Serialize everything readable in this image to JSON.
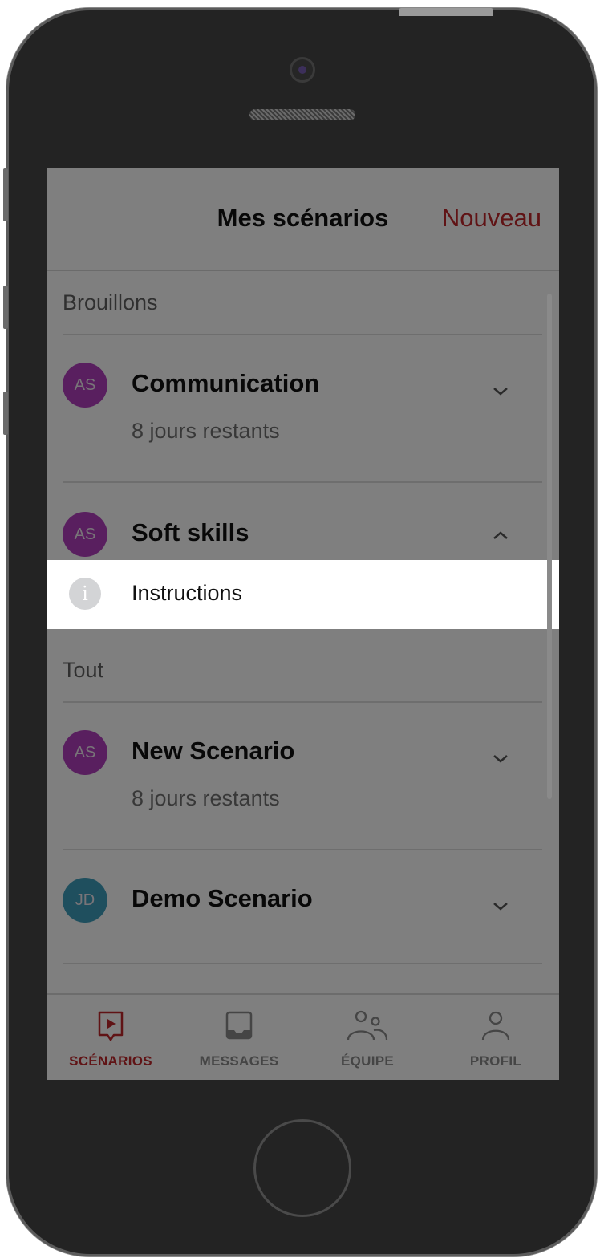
{
  "header": {
    "title": "Mes scénarios",
    "new_label": "Nouveau"
  },
  "sections": {
    "drafts_label": "Brouillons",
    "all_label": "Tout"
  },
  "drafts": [
    {
      "initials": "AS",
      "title": "Communication",
      "subtitle": "8 jours restants",
      "avatar_color": "#b23fbf"
    },
    {
      "initials": "AS",
      "title": "Soft skills",
      "avatar_color": "#b23fbf"
    }
  ],
  "instructions": {
    "label": "Instructions",
    "icon": "info-icon",
    "icon_glyph": "i"
  },
  "all": [
    {
      "initials": "AS",
      "title": "New Scenario",
      "subtitle": "8 jours restants",
      "avatar_color": "#b23fbf"
    },
    {
      "initials": "JD",
      "title": "Demo Scenario",
      "avatar_color": "#3e9fbd"
    }
  ],
  "tabs": [
    {
      "label": "SCÉNARIOS",
      "icon": "play-icon",
      "active": true
    },
    {
      "label": "MESSAGES",
      "icon": "inbox-icon",
      "active": false
    },
    {
      "label": "ÉQUIPE",
      "icon": "team-icon",
      "active": false
    },
    {
      "label": "PROFIL",
      "icon": "profile-icon",
      "active": false
    }
  ],
  "colors": {
    "accent": "#c0262b",
    "overlay": "rgba(0,0,0,0.5)"
  }
}
